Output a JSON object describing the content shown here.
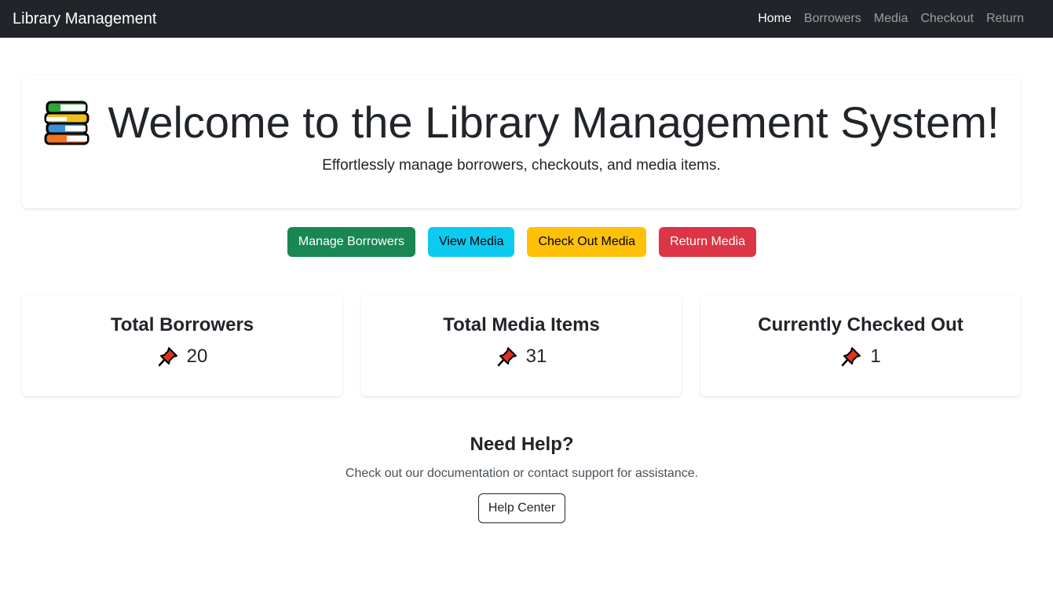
{
  "navbar": {
    "brand": "Library Management",
    "links": [
      {
        "label": "Home",
        "active": true
      },
      {
        "label": "Borrowers",
        "active": false
      },
      {
        "label": "Media",
        "active": false
      },
      {
        "label": "Checkout",
        "active": false
      },
      {
        "label": "Return",
        "active": false
      }
    ]
  },
  "hero": {
    "icon": "books-icon",
    "title": "Welcome to the Library Management System!",
    "subtitle": "Effortlessly manage borrowers, checkouts, and media items."
  },
  "actions": {
    "manage_borrowers": "Manage Borrowers",
    "view_media": "View Media",
    "check_out_media": "Check Out Media",
    "return_media": "Return Media"
  },
  "stats": [
    {
      "title": "Total Borrowers",
      "icon": "pushpin-icon",
      "value": "20"
    },
    {
      "title": "Total Media Items",
      "icon": "pushpin-icon",
      "value": "31"
    },
    {
      "title": "Currently Checked Out",
      "icon": "pushpin-icon",
      "value": "1"
    }
  ],
  "help": {
    "title": "Need Help?",
    "text": "Check out our documentation or contact support for assistance.",
    "button": "Help Center"
  },
  "colors": {
    "navbar_bg": "#212529",
    "success": "#198754",
    "info": "#0dcaf0",
    "warning": "#ffc107",
    "danger": "#dc3545"
  }
}
